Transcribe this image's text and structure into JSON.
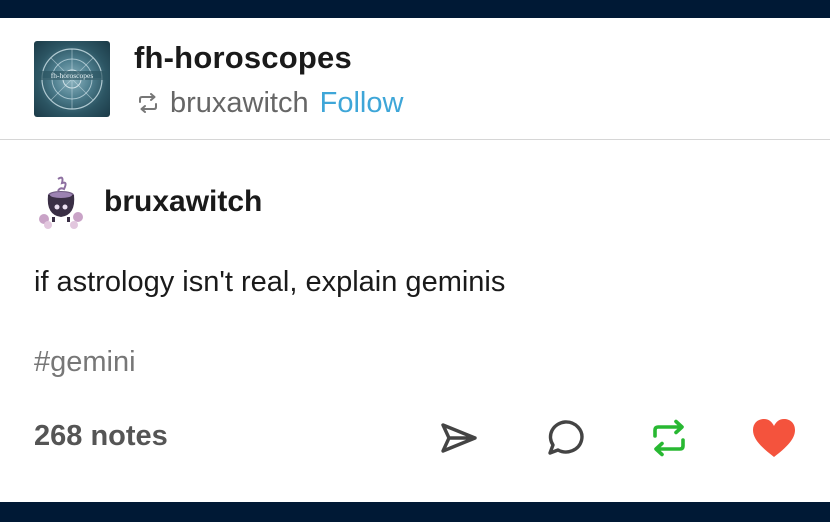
{
  "header": {
    "blog_name": "fh-horoscopes",
    "avatar_text": "fh-horoscopes",
    "reblogged_from": "bruxawitch",
    "follow_label": "Follow",
    "reblog_icon": "reblog-icon"
  },
  "post": {
    "author": "bruxawitch",
    "text": "if astrology isn't real, explain geminis",
    "tag": "#gemini"
  },
  "footer": {
    "notes_label": "268 notes",
    "actions": [
      {
        "name": "share-icon",
        "color": "#444444"
      },
      {
        "name": "reply-icon",
        "color": "#444444"
      },
      {
        "name": "reblog-icon",
        "color": "#28b832"
      },
      {
        "name": "heart-icon",
        "color": "#f4533d"
      }
    ]
  },
  "colors": {
    "background": "#001935",
    "follow": "#3ea6d8",
    "reblog_active": "#28b832",
    "like_active": "#f4533d"
  }
}
